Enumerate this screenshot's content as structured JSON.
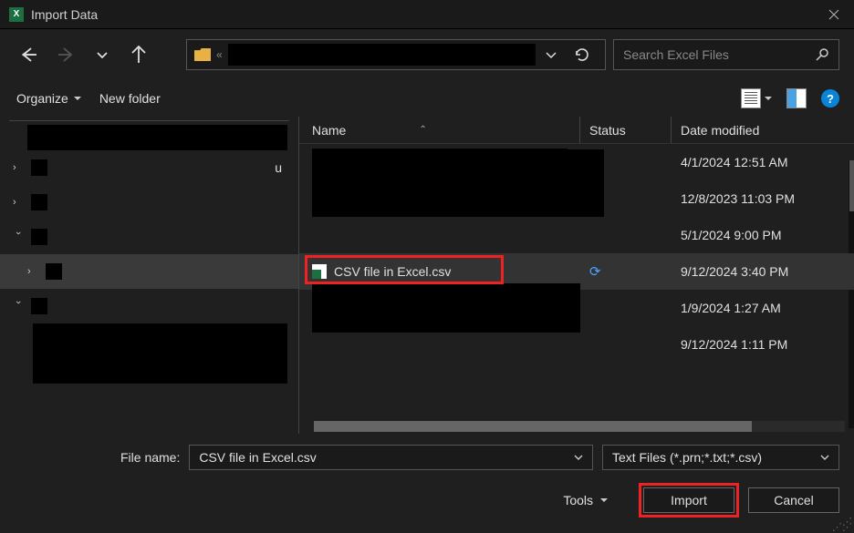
{
  "window": {
    "title": "Import Data"
  },
  "toolbar": {
    "organize": "Organize",
    "newfolder": "New folder"
  },
  "search": {
    "placeholder": "Search Excel Files"
  },
  "columns": {
    "name": "Name",
    "status": "Status",
    "date": "Date modified"
  },
  "files": [
    {
      "name": "",
      "status": "",
      "date": "4/1/2024 12:51 AM"
    },
    {
      "name": "",
      "status": "",
      "date": "12/8/2023 11:03 PM"
    },
    {
      "name": "",
      "status": "",
      "date": "5/1/2024 9:00 PM"
    },
    {
      "name": "CSV file in Excel.csv",
      "status": "sync",
      "date": "9/12/2024 3:40 PM",
      "highlighted": true
    },
    {
      "name": "",
      "status": "",
      "date": "1/9/2024 1:27 AM"
    },
    {
      "name": "",
      "status": "",
      "date": "9/12/2024 1:11 PM"
    }
  ],
  "footer": {
    "filename_label": "File name:",
    "filename_value": "CSV file in Excel.csv",
    "filetype_value": "Text Files (*.prn;*.txt;*.csv)",
    "tools": "Tools",
    "import": "Import",
    "cancel": "Cancel"
  },
  "sidebar": {
    "truncated_letter": "u"
  }
}
